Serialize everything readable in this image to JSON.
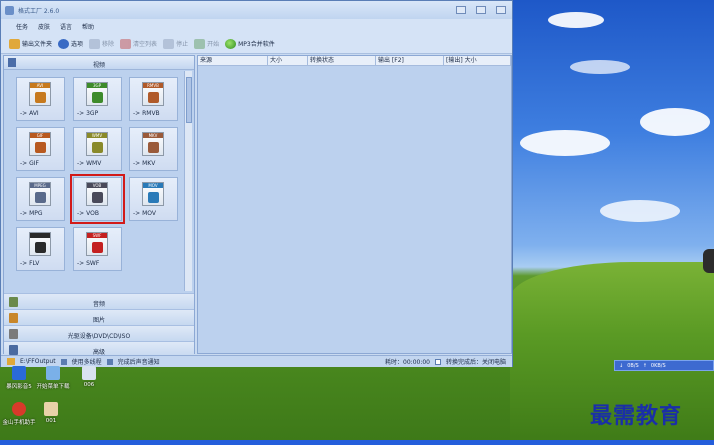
{
  "window": {
    "title": "格式工厂 2.6.0"
  },
  "menu": [
    "任务",
    "皮肤",
    "语言",
    "帮助"
  ],
  "toolbar": {
    "output_folder": "输出文件夹",
    "options": "选项",
    "remove": "移除",
    "clear_list": "清空列表",
    "stop": "停止",
    "start": "开始",
    "software": "MP3合并软件"
  },
  "panel": {
    "title": "视频"
  },
  "formats": [
    {
      "badge": "AVI",
      "label": "-> AVI",
      "color": "#c77a1e"
    },
    {
      "badge": "3GP",
      "label": "-> 3GP",
      "color": "#3e8b2b"
    },
    {
      "badge": "RMVB",
      "label": "-> RMVB",
      "color": "#b05a2a"
    },
    {
      "badge": "GIF",
      "label": "-> GIF",
      "color": "#b8591f"
    },
    {
      "badge": "WMV",
      "label": "-> WMV",
      "color": "#8a8a2a"
    },
    {
      "badge": "MKV",
      "label": "-> MKV",
      "color": "#9a5a3a"
    },
    {
      "badge": "MPEG",
      "label": "-> MPG",
      "color": "#5a6a8a"
    },
    {
      "badge": "VOB",
      "label": "-> VOB",
      "color": "#4a4a5a"
    },
    {
      "badge": "MOV",
      "label": "-> MOV",
      "color": "#2a7ab8"
    },
    {
      "badge": "",
      "label": "-> FLV",
      "color": "#2a2a2a"
    },
    {
      "badge": "SWF",
      "label": "-> SWF",
      "color": "#c42020"
    }
  ],
  "selected_format": "-> VOB",
  "categories": [
    "音频",
    "图片",
    "光驱设备\\DVD\\CD\\ISO",
    "高级"
  ],
  "table": {
    "columns": [
      "来源",
      "大小",
      "转换状态",
      "输出 [F2]",
      "[输出] 大小"
    ]
  },
  "status": {
    "output_path": "E:\\FFOutput",
    "multithread": "使用多线程",
    "sound_notify": "完成后声音通知",
    "elapsed": "耗时：00:00:00",
    "after_convert": "转换完成后：关闭电脑"
  },
  "desktop_icons": [
    {
      "label": "暴风影音5"
    },
    {
      "label": "开始菜单下载"
    },
    {
      "label": "006"
    },
    {
      "label": "金山手机助手"
    },
    {
      "label": "001"
    }
  ],
  "tray": {
    "down": "0B/S",
    "up": "0KB/S"
  },
  "watermark": "最需教育"
}
